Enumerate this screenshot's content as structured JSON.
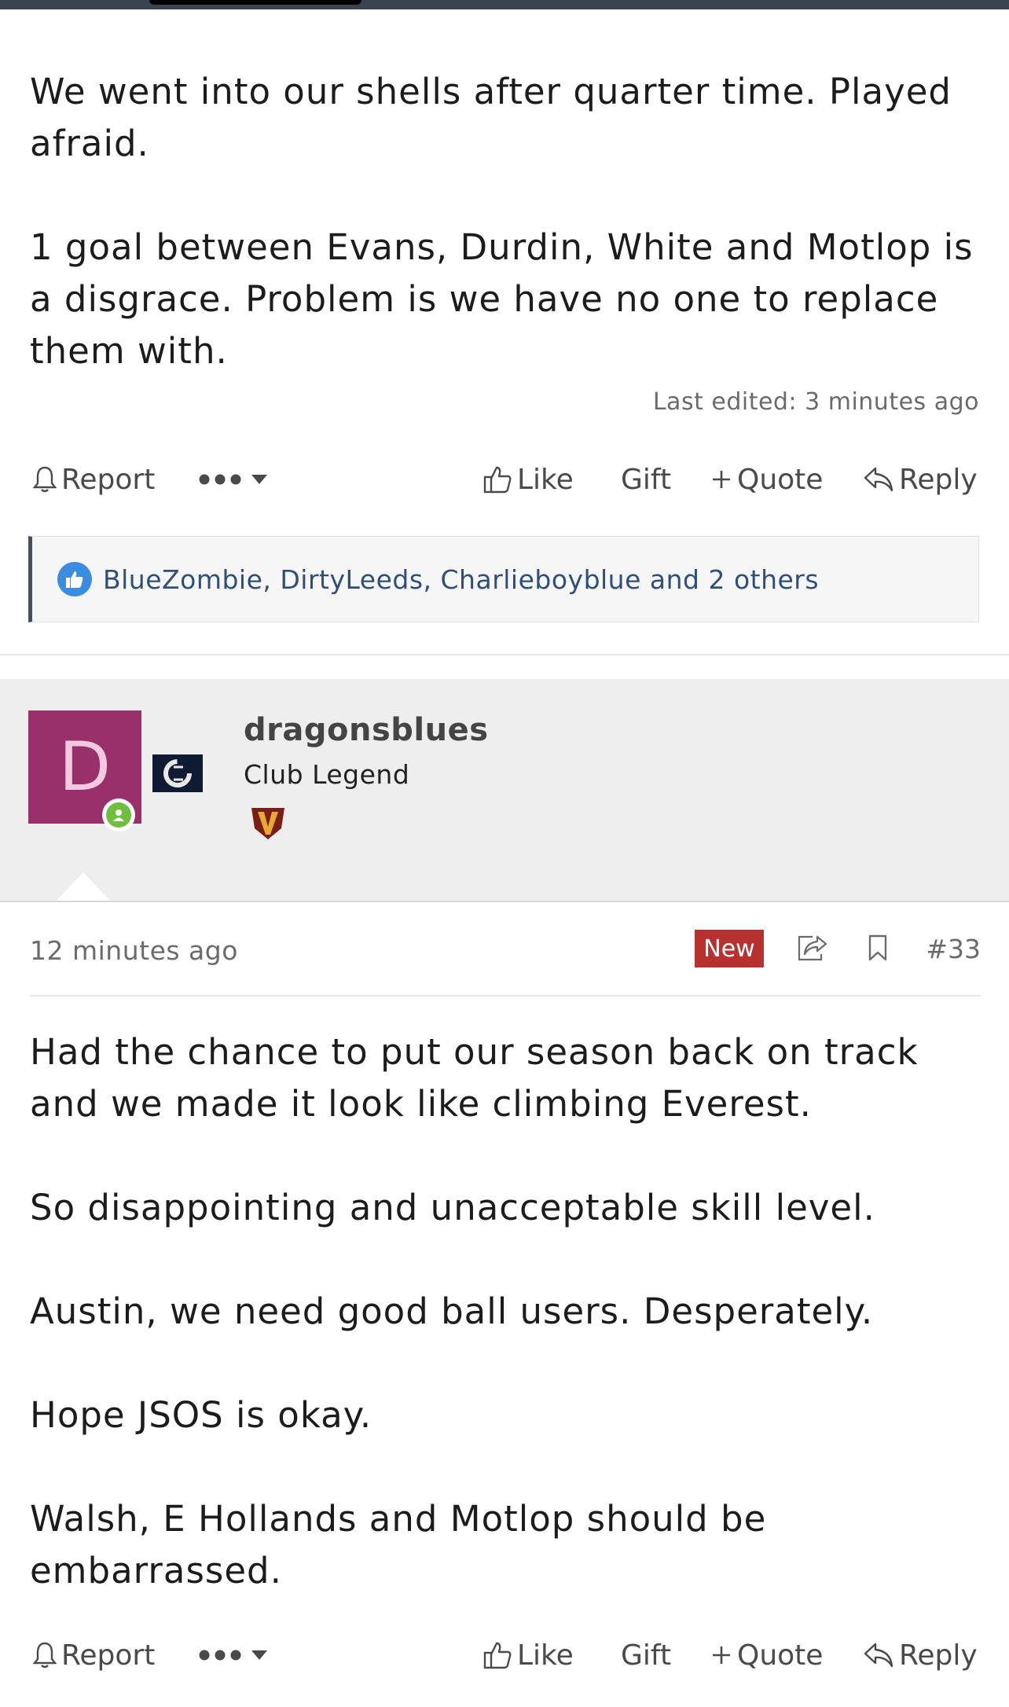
{
  "post1": {
    "paragraphs": [
      "We went into our shells after quarter time. Played afraid.",
      "1 goal between Evans, Durdin, White and Motlop is a disgrace. Problem is we have no one to replace them with."
    ],
    "last_edited": "Last edited: 3 minutes ago",
    "actions": {
      "report": "Report",
      "like": "Like",
      "gift": "Gift",
      "quote": "Quote",
      "reply": "Reply"
    },
    "reactions": "BlueZombie, DirtyLeeds, Charlieboyblue and 2 others"
  },
  "post2": {
    "user": {
      "avatar_letter": "D",
      "name": "dragonsblues",
      "title": "Club Legend"
    },
    "time": "12 minutes ago",
    "new_label": "New",
    "post_number": "#33",
    "paragraphs": [
      "Had the chance to put our season back on track and we made it look like climbing Everest.",
      "So disappointing and unacceptable skill level.",
      "Austin, we need good ball users. Desperately.",
      "Hope JSOS is okay.",
      "Walsh, E Hollands and Motlop should be embarrassed."
    ],
    "actions": {
      "report": "Report",
      "like": "Like",
      "gift": "Gift",
      "quote": "Quote",
      "reply": "Reply"
    }
  },
  "colors": {
    "avatar_bg": "#99306c",
    "new_badge": "#b8312f",
    "like_blue": "#3b8de0",
    "online": "#6fbf3f"
  },
  "icons": [
    "bell-icon",
    "more-icon",
    "thumbs-up-icon",
    "plus-icon",
    "reply-icon",
    "share-icon",
    "bookmark-icon",
    "club-logo-icon",
    "rank-badge-icon"
  ]
}
